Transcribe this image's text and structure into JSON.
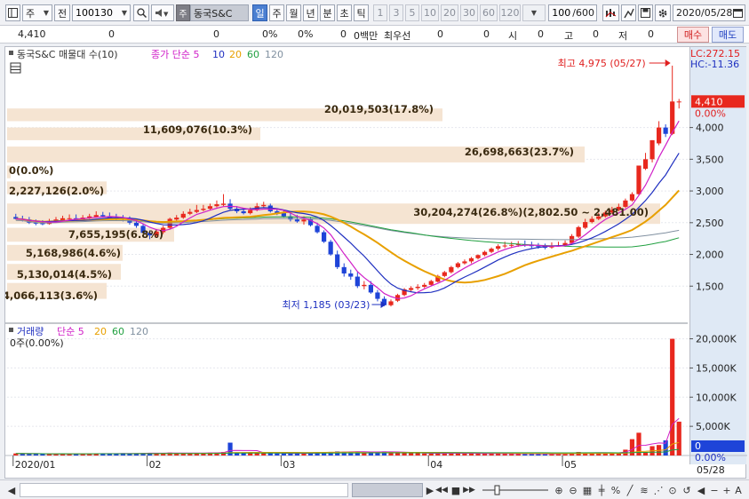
{
  "toolbar": {
    "market": "주",
    "market_prefix": "전",
    "code": "100130",
    "badge": "주",
    "stock_name": "동국S&C",
    "periods": [
      "일",
      "주",
      "월",
      "년",
      "분",
      "초",
      "틱"
    ],
    "selected_period": "일",
    "intervals": [
      "1",
      "3",
      "5",
      "10",
      "20",
      "30",
      "60",
      "120"
    ],
    "zoom": "100",
    "zoom_total": "/600",
    "date": "2020/05/28"
  },
  "quote": {
    "price": "4,410",
    "change": "0",
    "v1": "0",
    "p1": "0%",
    "v2": "0",
    "p2": "0%",
    "amount_label": "0백만",
    "best_label": "최우선",
    "best_bid": "0",
    "best_ask": "0",
    "open_label": "시",
    "open": "0",
    "high_label": "고",
    "high": "0",
    "low_label": "저",
    "low": "0",
    "buy": "매수",
    "sell": "매도"
  },
  "price_panel": {
    "legend1": "동국S&C 매물대 수(10)",
    "legend2": "종가 단순 5",
    "ma_labels": [
      "10",
      "20",
      "60",
      "120"
    ],
    "lc": "LC:272.15",
    "hc": "HC:-11.36",
    "high_note": "최고 4,975 (05/27)",
    "low_note": "최저 1,185 (03/23)",
    "current": "4,410",
    "current_pct": "0.00%",
    "axis_ticks": [
      "4,000",
      "3,500",
      "3,000",
      "2,500",
      "2,000",
      "1,500"
    ],
    "volume_profile": [
      "20,019,503(17.8%)",
      "11,609,076(10.3%)",
      "26,698,663(23.7%)",
      "0(0.0%)",
      "2,227,126(2.0%)",
      "30,204,274(26.8%)(2,802.50 ~ 2,481.00)",
      "7,655,195(6.8%)",
      "5,168,986(4.6%)",
      "5,130,014(4.5%)",
      "4,066,113(3.6%)"
    ]
  },
  "volume_panel": {
    "legend1": "거래량",
    "legend2": "단순 5",
    "ma_labels": [
      "20",
      "60",
      "120"
    ],
    "info": "0주(0.00%)",
    "axis_ticks": [
      "20,000K",
      "15,000K",
      "10,000K",
      "5,000K"
    ],
    "current": "0",
    "current_pct": "0.00%"
  },
  "x_axis": {
    "labels": [
      "2020/01",
      "02",
      "03",
      "04",
      "05"
    ],
    "right_label": "05/28"
  },
  "colors": {
    "up": "#e8281e",
    "down": "#1e44d8",
    "ma5": "#d020c8",
    "ma10": "#2030c0",
    "ma20": "#e8a000",
    "ma60": "#20a040",
    "ma120": "#8090a0",
    "profile": "#f5e4d2"
  },
  "chart_data": {
    "type": "candlestick",
    "x": [
      "01/02",
      "01/03",
      "01/06",
      "01/07",
      "01/08",
      "01/09",
      "01/10",
      "01/13",
      "01/14",
      "01/15",
      "01/16",
      "01/17",
      "01/20",
      "01/21",
      "01/22",
      "01/23",
      "01/28",
      "01/29",
      "01/30",
      "01/31",
      "02/03",
      "02/04",
      "02/05",
      "02/06",
      "02/07",
      "02/10",
      "02/11",
      "02/12",
      "02/13",
      "02/14",
      "02/17",
      "02/18",
      "02/19",
      "02/20",
      "02/21",
      "02/24",
      "02/25",
      "02/26",
      "02/27",
      "02/28",
      "03/02",
      "03/03",
      "03/04",
      "03/05",
      "03/06",
      "03/09",
      "03/10",
      "03/11",
      "03/12",
      "03/13",
      "03/16",
      "03/17",
      "03/18",
      "03/19",
      "03/20",
      "03/23",
      "03/24",
      "03/25",
      "03/26",
      "03/27",
      "03/30",
      "03/31",
      "04/01",
      "04/02",
      "04/03",
      "04/06",
      "04/07",
      "04/08",
      "04/09",
      "04/10",
      "04/13",
      "04/14",
      "04/16",
      "04/17",
      "04/20",
      "04/21",
      "04/22",
      "04/23",
      "04/24",
      "04/27",
      "04/28",
      "04/29",
      "05/04",
      "05/06",
      "05/07",
      "05/08",
      "05/11",
      "05/12",
      "05/13",
      "05/14",
      "05/15",
      "05/18",
      "05/19",
      "05/20",
      "05/21",
      "05/22",
      "05/25",
      "05/26",
      "05/27",
      "05/28"
    ],
    "open": [
      2590,
      2560,
      2550,
      2500,
      2490,
      2480,
      2520,
      2540,
      2560,
      2570,
      2550,
      2580,
      2590,
      2620,
      2600,
      2580,
      2570,
      2550,
      2500,
      2450,
      2340,
      2300,
      2350,
      2420,
      2550,
      2580,
      2640,
      2670,
      2700,
      2720,
      2760,
      2780,
      2800,
      2720,
      2680,
      2650,
      2700,
      2760,
      2770,
      2680,
      2650,
      2600,
      2550,
      2520,
      2550,
      2450,
      2350,
      2200,
      2000,
      1800,
      1700,
      1650,
      1500,
      1520,
      1400,
      1300,
      1200,
      1270,
      1360,
      1440,
      1470,
      1490,
      1520,
      1570,
      1660,
      1720,
      1800,
      1860,
      1890,
      1940,
      1990,
      2040,
      2090,
      2130,
      2140,
      2150,
      2160,
      2150,
      2130,
      2120,
      2110,
      2140,
      2140,
      2180,
      2280,
      2420,
      2510,
      2560,
      2600,
      2660,
      2700,
      2750,
      2850,
      2950,
      3350,
      3500,
      3750,
      4000,
      3900,
      4410
    ],
    "high": [
      2640,
      2610,
      2590,
      2550,
      2540,
      2560,
      2590,
      2610,
      2630,
      2630,
      2620,
      2640,
      2680,
      2670,
      2660,
      2640,
      2620,
      2600,
      2540,
      2480,
      2380,
      2400,
      2450,
      2580,
      2620,
      2680,
      2720,
      2780,
      2780,
      2800,
      2850,
      2950,
      2870,
      2760,
      2730,
      2740,
      2810,
      2830,
      2800,
      2720,
      2700,
      2650,
      2620,
      2600,
      2580,
      2500,
      2380,
      2230,
      2060,
      1860,
      1760,
      1720,
      1580,
      1580,
      1440,
      1340,
      1290,
      1380,
      1470,
      1500,
      1530,
      1550,
      1600,
      1680,
      1740,
      1820,
      1880,
      1920,
      1960,
      2000,
      2060,
      2110,
      2160,
      2200,
      2200,
      2210,
      2220,
      2200,
      2180,
      2170,
      2190,
      2200,
      2220,
      2320,
      2450,
      2560,
      2600,
      2650,
      2690,
      2750,
      2800,
      2880,
      2980,
      3400,
      3600,
      3800,
      4100,
      4050,
      4975,
      4450
    ],
    "low": [
      2550,
      2520,
      2480,
      2460,
      2460,
      2470,
      2500,
      2520,
      2540,
      2540,
      2530,
      2560,
      2580,
      2580,
      2560,
      2540,
      2520,
      2470,
      2420,
      2330,
      2240,
      2270,
      2320,
      2400,
      2530,
      2560,
      2620,
      2650,
      2680,
      2700,
      2740,
      2760,
      2700,
      2650,
      2630,
      2630,
      2680,
      2730,
      2660,
      2620,
      2580,
      2520,
      2500,
      2470,
      2440,
      2330,
      2180,
      1980,
      1770,
      1650,
      1600,
      1470,
      1450,
      1380,
      1260,
      1185,
      1180,
      1250,
      1340,
      1410,
      1440,
      1470,
      1510,
      1560,
      1640,
      1700,
      1780,
      1840,
      1860,
      1920,
      1970,
      2020,
      2060,
      2100,
      2100,
      2120,
      2120,
      2100,
      2090,
      2080,
      2090,
      2120,
      2120,
      2160,
      2260,
      2400,
      2490,
      2540,
      2580,
      2640,
      2680,
      2730,
      2830,
      2930,
      3330,
      3450,
      3720,
      3850,
      3880,
      4300
    ],
    "close": [
      2560,
      2550,
      2500,
      2490,
      2480,
      2530,
      2550,
      2570,
      2570,
      2550,
      2580,
      2600,
      2620,
      2600,
      2580,
      2570,
      2550,
      2500,
      2450,
      2340,
      2300,
      2360,
      2420,
      2560,
      2580,
      2640,
      2670,
      2700,
      2720,
      2760,
      2790,
      2800,
      2720,
      2680,
      2650,
      2700,
      2760,
      2780,
      2680,
      2650,
      2600,
      2550,
      2520,
      2550,
      2460,
      2350,
      2200,
      2000,
      1800,
      1700,
      1650,
      1500,
      1520,
      1400,
      1300,
      1200,
      1260,
      1360,
      1450,
      1470,
      1490,
      1520,
      1580,
      1660,
      1720,
      1800,
      1860,
      1890,
      1940,
      1990,
      2040,
      2090,
      2130,
      2140,
      2150,
      2160,
      2150,
      2130,
      2120,
      2110,
      2140,
      2140,
      2180,
      2290,
      2430,
      2510,
      2560,
      2600,
      2660,
      2700,
      2750,
      2850,
      2950,
      3400,
      3500,
      3800,
      4000,
      3900,
      4410,
      4410
    ],
    "volume": [
      350,
      320,
      280,
      300,
      260,
      270,
      290,
      310,
      280,
      260,
      300,
      330,
      350,
      320,
      300,
      280,
      400,
      380,
      350,
      420,
      450,
      380,
      350,
      500,
      420,
      380,
      440,
      400,
      450,
      500,
      520,
      600,
      2200,
      500,
      450,
      480,
      520,
      400,
      380,
      350,
      360,
      320,
      420,
      380,
      400,
      480,
      550,
      620,
      700,
      650,
      600,
      700,
      550,
      580,
      620,
      700,
      650,
      480,
      420,
      400,
      380,
      350,
      340,
      360,
      420,
      400,
      380,
      350,
      360,
      340,
      330,
      350,
      320,
      300,
      280,
      290,
      300,
      280,
      270,
      260,
      300,
      280,
      350,
      420,
      600,
      500,
      450,
      420,
      400,
      500,
      480,
      1000,
      2800,
      3900,
      600,
      1600,
      1800,
      2600,
      20000,
      5800
    ],
    "ylim_price": [
      1000,
      5100
    ],
    "ylim_volume": [
      0,
      21000
    ],
    "volume_unit": "K"
  }
}
